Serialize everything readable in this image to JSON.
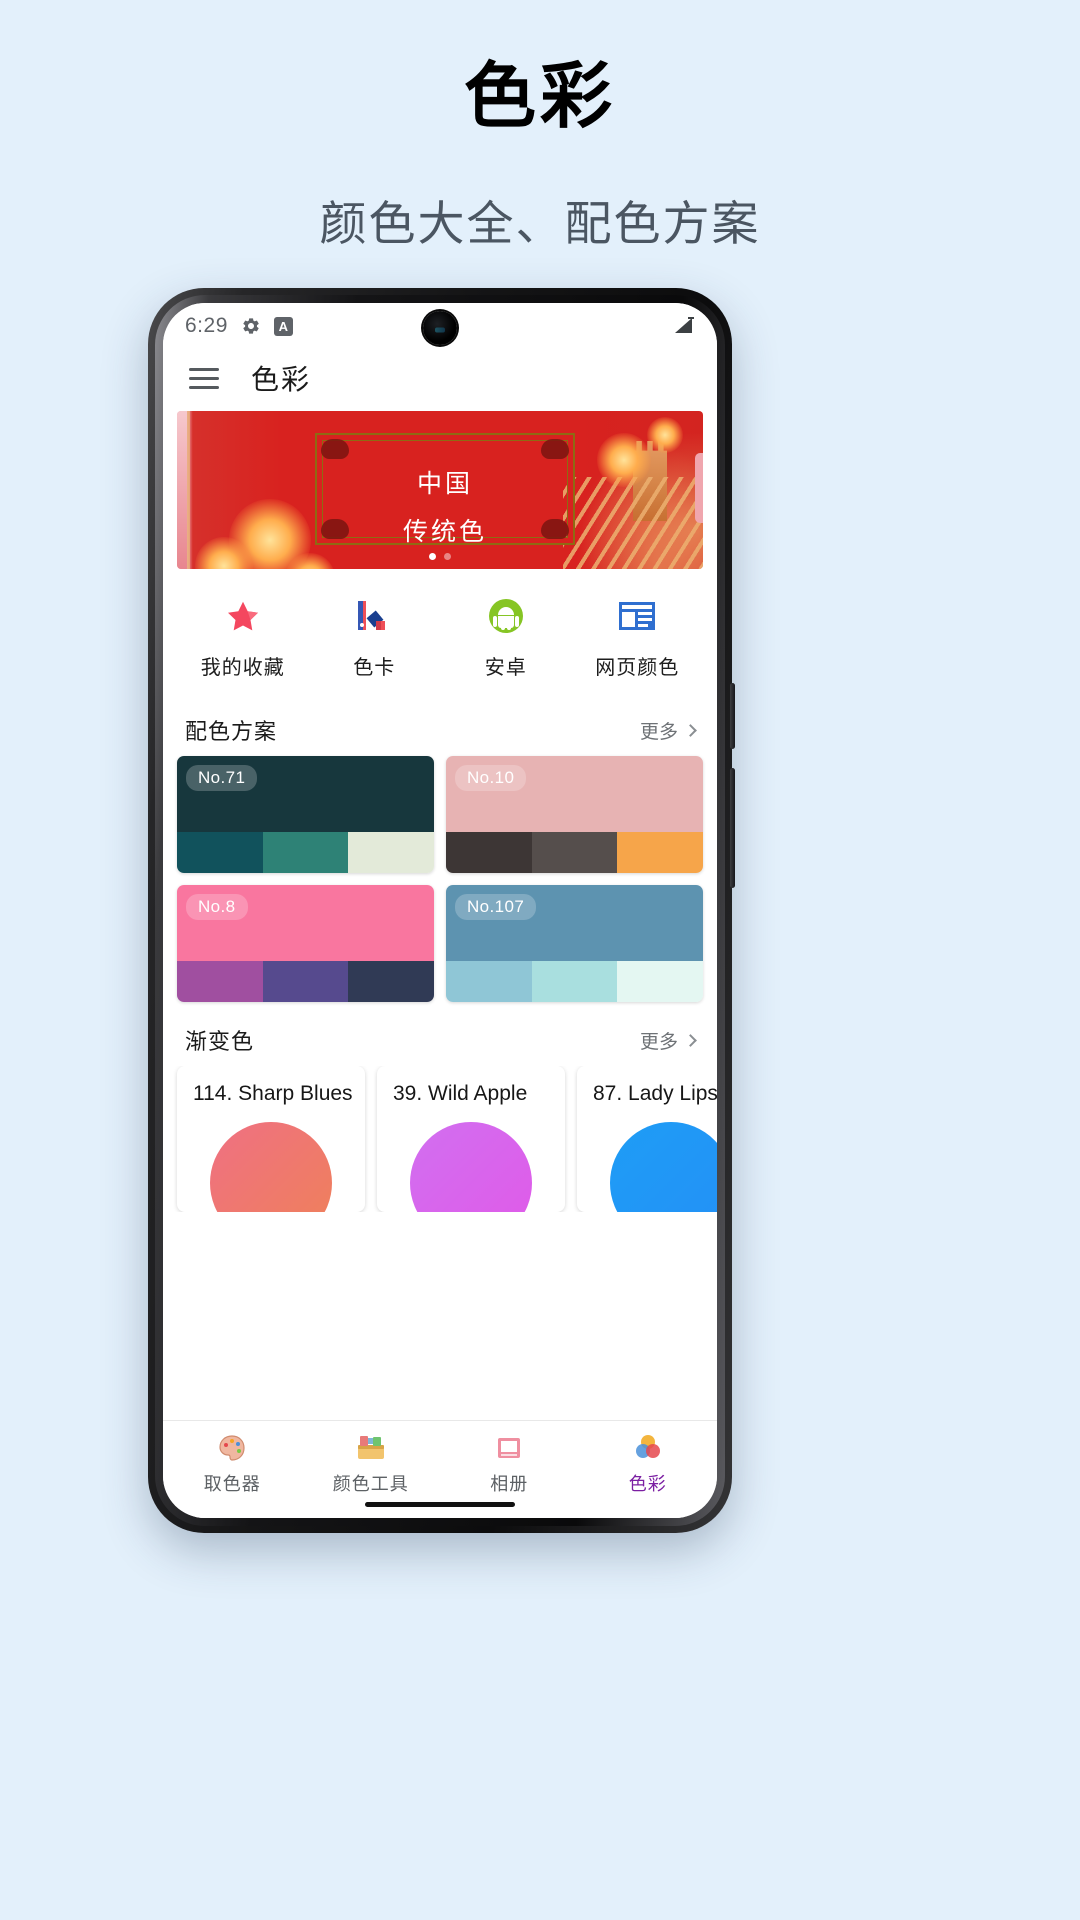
{
  "promo": {
    "title": "色彩",
    "subtitle": "颜色大全、配色方案"
  },
  "phone": {
    "statusbar": {
      "time": "6:29",
      "gear_icon": "gear-icon",
      "a_icon": "A",
      "right_icon": "signal-icon"
    },
    "toolbar": {
      "menu_icon": "hamburger-menu-icon",
      "title": "色彩"
    },
    "banner": {
      "line1": "中国",
      "line2": "传统色",
      "pager": {
        "total": 2,
        "active": 0
      }
    },
    "quick_actions": [
      {
        "icon": "star-icon",
        "label": "我的收藏"
      },
      {
        "icon": "swatch-icon",
        "label": "色卡"
      },
      {
        "icon": "android-icon",
        "label": "安卓"
      },
      {
        "icon": "webpage-icon",
        "label": "网页颜色"
      }
    ],
    "sections": [
      {
        "title": "配色方案",
        "more": "更多"
      },
      {
        "title": "渐变色",
        "more": "更多"
      }
    ],
    "palettes": [
      {
        "name": "No.71",
        "main": "#17373d",
        "strip": [
          "#11525c",
          "#2e8276",
          "#e3ead9"
        ],
        "badge_color": "#ffffff"
      },
      {
        "name": "No.10",
        "main": "#e7b3b3",
        "strip": [
          "#3d3635",
          "#554e4c",
          "#f6a54a"
        ],
        "badge_color": "#ffffff"
      },
      {
        "name": "No.8",
        "main": "#f9769f",
        "strip": [
          "#a04fa0",
          "#564a8e",
          "#303a55"
        ],
        "badge_color": "#ffffff"
      },
      {
        "name": "No.107",
        "main": "#5d93b0",
        "strip": [
          "#8fc6d6",
          "#a9dfdf",
          "#e4f7f2"
        ],
        "badge_color": "#ffffff"
      }
    ],
    "gradients": [
      {
        "name": "114. Sharp Blues",
        "from": "#ef7083",
        "to": "#ef8159"
      },
      {
        "name": "39. Wild Apple",
        "from": "#d16ff0",
        "to": "#e05ae8"
      },
      {
        "name": "87. Lady Lips",
        "from": "#1e9df5",
        "to": "#2490f7"
      }
    ],
    "bottom_nav": [
      {
        "icon": "color-picker-icon",
        "label": "取色器",
        "active": false
      },
      {
        "icon": "color-tools-icon",
        "label": "颜色工具",
        "active": false
      },
      {
        "icon": "album-icon",
        "label": "相册",
        "active": false
      },
      {
        "icon": "colors-icon",
        "label": "色彩",
        "active": true
      }
    ]
  },
  "theme": {
    "page_bg": "#e3f0fb",
    "accent": "#7b1fa2",
    "banner_red": "#d8221f"
  }
}
